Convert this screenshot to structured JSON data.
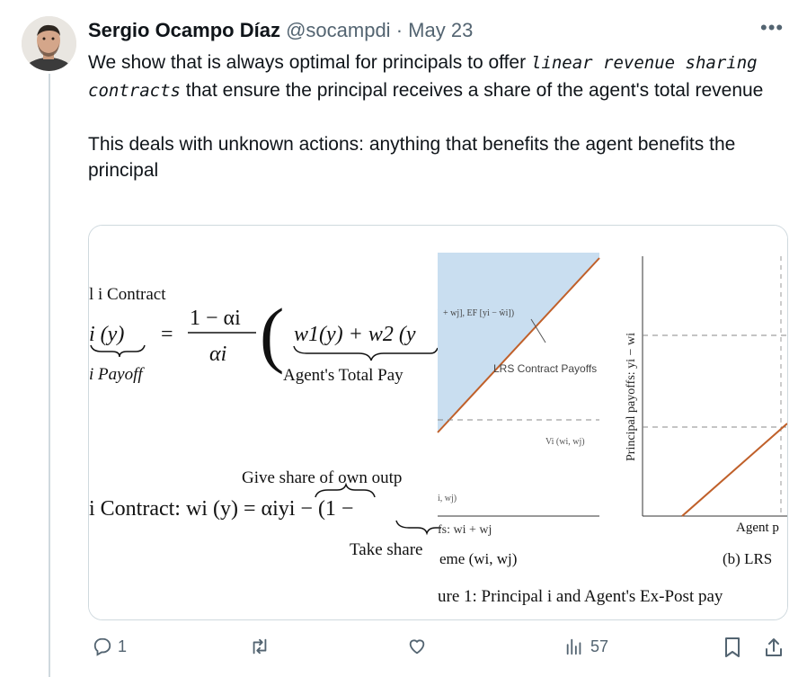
{
  "tweet": {
    "author_name": "Sergio Ocampo Díaz",
    "handle": "@socampdi",
    "separator": "·",
    "date": "May 23",
    "more_label": "•••",
    "text": {
      "line1_pre": "We show that is always optimal for principals to offer ",
      "line1_emph": "linear revenue sharing contracts",
      "line1_post": " that ensure the principal receives a share of the agent's total revenue",
      "line2": "This deals with unknown actions: anything that benefits the agent benefits the principal"
    }
  },
  "media": {
    "eq1_heading": "l i Contract",
    "eq1_left": "i (y)",
    "eq1_left_label": "i Payoff",
    "eq1_eq": "=",
    "eq1_num": "1 − αi",
    "eq1_den": "αi",
    "eq1_paren": "(",
    "eq1_body": "w1(y) + w2 (y",
    "eq1_body_label": "Agent's Total Pay",
    "eq2_over": "Give share of own outp",
    "eq2_main": "i Contract:   wi (y) = αiyi − (1 −",
    "eq2_under": "Take share",
    "chart_annot1": "+ wj], EF [yi − ŵi])",
    "chart_annot2": "LRS Contract Payoffs",
    "chart_annot3": "Vi (wi, wj)",
    "chart_annot4": "i, wj)",
    "chart_annot5": "fs: wi + wj",
    "caption_a": "eme (wi, wj)",
    "ylabel_b": "Principal payoffs: yi − wi",
    "xlabel_b": "Agent p",
    "caption_b": "(b) LRS",
    "figure_caption": "ure 1: Principal i and Agent's Ex-Post pay"
  },
  "actions": {
    "reply_count": "1",
    "repost_count": "",
    "like_count": "",
    "views_count": "57"
  },
  "colors": {
    "accent_text": "#0f1419",
    "secondary_text": "#536471",
    "border": "#cfd9de",
    "chart_fill": "#c9def0",
    "chart_line": "#c0602a"
  }
}
